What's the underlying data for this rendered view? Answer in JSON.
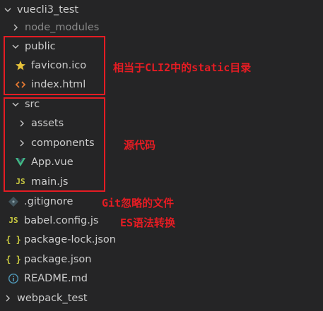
{
  "tree": {
    "root": {
      "label": "vuecli3_test",
      "expanded": true
    },
    "node_modules": {
      "label": "node_modules",
      "expanded": false
    },
    "public": {
      "label": "public",
      "expanded": true,
      "children": [
        "favicon.ico",
        "index.html"
      ]
    },
    "src": {
      "label": "src",
      "expanded": true,
      "folders": [
        "assets",
        "components"
      ],
      "files": [
        "App.vue",
        "main.js"
      ]
    },
    "root_files": [
      ".gitignore",
      "babel.config.js",
      "package-lock.json",
      "package.json",
      "README.md"
    ],
    "sibling": {
      "label": "webpack_test",
      "expanded": false
    }
  },
  "icons": {
    "favicon": "star-icon",
    "html": "code-brackets-icon",
    "vue": "vue-logo-icon",
    "js": "js-icon",
    "git": "git-diamond-icon",
    "json": "json-braces-icon",
    "readme": "info-icon",
    "js_text": "JS",
    "json_text": "{ }"
  },
  "annotations": {
    "public_note": "相当于CLI2中的static目录",
    "src_note": "源代码",
    "gitignore_note": "Git忽略的文件",
    "babel_note": "ES语法转换"
  },
  "colors": {
    "background": "#252526",
    "text": "#cccccc",
    "dim_text": "#8a8a8a",
    "annotation_red": "#e51c23",
    "star_yellow": "#e8c33a",
    "html_orange": "#e37933",
    "vue_green": "#41b883",
    "js_yellow": "#cbcb41",
    "json_yellow": "#cbcb41",
    "info_blue": "#519aba",
    "git_gray": "#41535b"
  }
}
